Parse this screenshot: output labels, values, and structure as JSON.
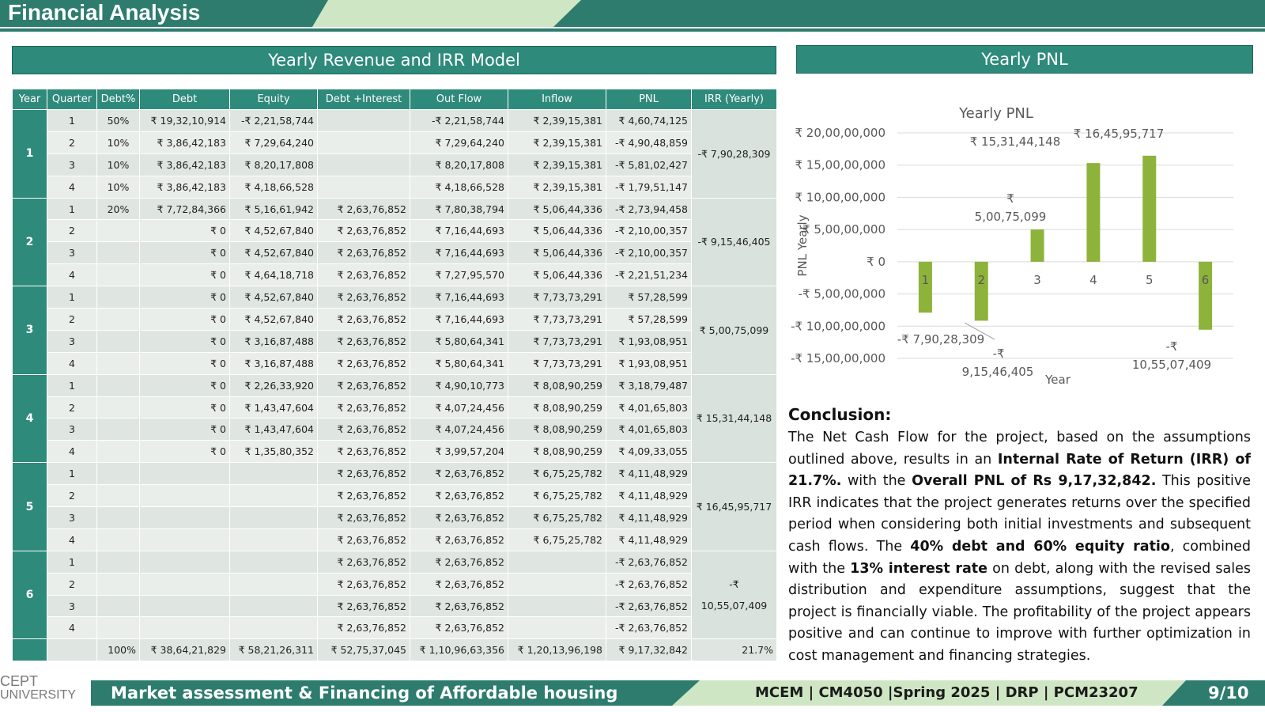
{
  "header": {
    "title": "Financial Analysis"
  },
  "table_section": {
    "title": "Yearly Revenue and IRR Model"
  },
  "chart_section": {
    "title": "Yearly PNL"
  },
  "table": {
    "columns": [
      "Year",
      "Quarter",
      "Debt%",
      "Debt",
      "Equity",
      "Debt +Interest",
      "Out Flow",
      "Inflow",
      "PNL",
      "IRR (Yearly)"
    ],
    "years": [
      {
        "year": "1",
        "irr": "-₹ 7,90,28,309",
        "rows": [
          [
            "1",
            "50%",
            "₹ 19,32,10,914",
            "-₹ 2,21,58,744",
            "",
            "-₹ 2,21,58,744",
            "₹ 2,39,15,381",
            "₹ 4,60,74,125"
          ],
          [
            "2",
            "10%",
            "₹ 3,86,42,183",
            "₹ 7,29,64,240",
            "",
            "₹ 7,29,64,240",
            "₹ 2,39,15,381",
            "-₹ 4,90,48,859"
          ],
          [
            "3",
            "10%",
            "₹ 3,86,42,183",
            "₹ 8,20,17,808",
            "",
            "₹ 8,20,17,808",
            "₹ 2,39,15,381",
            "-₹ 5,81,02,427"
          ],
          [
            "4",
            "10%",
            "₹ 3,86,42,183",
            "₹ 4,18,66,528",
            "",
            "₹ 4,18,66,528",
            "₹ 2,39,15,381",
            "-₹ 1,79,51,147"
          ]
        ]
      },
      {
        "year": "2",
        "irr": "-₹ 9,15,46,405",
        "rows": [
          [
            "1",
            "20%",
            "₹ 7,72,84,366",
            "₹ 5,16,61,942",
            "₹ 2,63,76,852",
            "₹ 7,80,38,794",
            "₹ 5,06,44,336",
            "-₹ 2,73,94,458"
          ],
          [
            "2",
            "",
            "₹ 0",
            "₹ 4,52,67,840",
            "₹ 2,63,76,852",
            "₹ 7,16,44,693",
            "₹ 5,06,44,336",
            "-₹ 2,10,00,357"
          ],
          [
            "3",
            "",
            "₹ 0",
            "₹ 4,52,67,840",
            "₹ 2,63,76,852",
            "₹ 7,16,44,693",
            "₹ 5,06,44,336",
            "-₹ 2,10,00,357"
          ],
          [
            "4",
            "",
            "₹ 0",
            "₹ 4,64,18,718",
            "₹ 2,63,76,852",
            "₹ 7,27,95,570",
            "₹ 5,06,44,336",
            "-₹ 2,21,51,234"
          ]
        ]
      },
      {
        "year": "3",
        "irr": "₹ 5,00,75,099",
        "rows": [
          [
            "1",
            "",
            "₹ 0",
            "₹ 4,52,67,840",
            "₹ 2,63,76,852",
            "₹ 7,16,44,693",
            "₹ 7,73,73,291",
            "₹ 57,28,599"
          ],
          [
            "2",
            "",
            "₹ 0",
            "₹ 4,52,67,840",
            "₹ 2,63,76,852",
            "₹ 7,16,44,693",
            "₹ 7,73,73,291",
            "₹ 57,28,599"
          ],
          [
            "3",
            "",
            "₹ 0",
            "₹ 3,16,87,488",
            "₹ 2,63,76,852",
            "₹ 5,80,64,341",
            "₹ 7,73,73,291",
            "₹ 1,93,08,951"
          ],
          [
            "4",
            "",
            "₹ 0",
            "₹ 3,16,87,488",
            "₹ 2,63,76,852",
            "₹ 5,80,64,341",
            "₹ 7,73,73,291",
            "₹ 1,93,08,951"
          ]
        ]
      },
      {
        "year": "4",
        "irr": "₹ 15,31,44,148",
        "rows": [
          [
            "1",
            "",
            "₹ 0",
            "₹ 2,26,33,920",
            "₹ 2,63,76,852",
            "₹ 4,90,10,773",
            "₹ 8,08,90,259",
            "₹ 3,18,79,487"
          ],
          [
            "2",
            "",
            "₹ 0",
            "₹ 1,43,47,604",
            "₹ 2,63,76,852",
            "₹ 4,07,24,456",
            "₹ 8,08,90,259",
            "₹ 4,01,65,803"
          ],
          [
            "3",
            "",
            "₹ 0",
            "₹ 1,43,47,604",
            "₹ 2,63,76,852",
            "₹ 4,07,24,456",
            "₹ 8,08,90,259",
            "₹ 4,01,65,803"
          ],
          [
            "4",
            "",
            "₹ 0",
            "₹ 1,35,80,352",
            "₹ 2,63,76,852",
            "₹ 3,99,57,204",
            "₹ 8,08,90,259",
            "₹ 4,09,33,055"
          ]
        ]
      },
      {
        "year": "5",
        "irr": "₹ 16,45,95,717",
        "rows": [
          [
            "1",
            "",
            "",
            "",
            "₹ 2,63,76,852",
            "₹ 2,63,76,852",
            "₹ 6,75,25,782",
            "₹ 4,11,48,929"
          ],
          [
            "2",
            "",
            "",
            "",
            "₹ 2,63,76,852",
            "₹ 2,63,76,852",
            "₹ 6,75,25,782",
            "₹ 4,11,48,929"
          ],
          [
            "3",
            "",
            "",
            "",
            "₹ 2,63,76,852",
            "₹ 2,63,76,852",
            "₹ 6,75,25,782",
            "₹ 4,11,48,929"
          ],
          [
            "4",
            "",
            "",
            "",
            "₹ 2,63,76,852",
            "₹ 2,63,76,852",
            "₹ 6,75,25,782",
            "₹ 4,11,48,929"
          ]
        ]
      },
      {
        "year": "6",
        "irr": "-₹ 10,55,07,409",
        "rows": [
          [
            "1",
            "",
            "",
            "",
            "₹ 2,63,76,852",
            "₹ 2,63,76,852",
            "",
            "-₹ 2,63,76,852"
          ],
          [
            "2",
            "",
            "",
            "",
            "₹ 2,63,76,852",
            "₹ 2,63,76,852",
            "",
            "-₹ 2,63,76,852"
          ],
          [
            "3",
            "",
            "",
            "",
            "₹ 2,63,76,852",
            "₹ 2,63,76,852",
            "",
            "-₹ 2,63,76,852"
          ],
          [
            "4",
            "",
            "",
            "",
            "₹ 2,63,76,852",
            "₹ 2,63,76,852",
            "",
            "-₹ 2,63,76,852"
          ]
        ]
      }
    ],
    "totals": [
      "",
      "",
      "100%",
      "₹ 38,64,21,829",
      "₹ 58,21,26,311",
      "₹ 52,75,37,045",
      "₹ 1,10,96,63,356",
      "₹ 1,20,13,96,198",
      "₹ 9,17,32,842",
      "21.7%"
    ]
  },
  "chart_data": {
    "type": "bar",
    "title": "Yearly PNL",
    "xlabel": "Year",
    "ylabel": "PNL Yearly",
    "categories": [
      "1",
      "2",
      "3",
      "4",
      "5",
      "6"
    ],
    "values": [
      -79028309,
      -91546405,
      50075099,
      153144148,
      164595717,
      -105507409
    ],
    "data_labels": [
      "-₹ 7,90,28,309",
      "-₹ 9,15,46,405",
      "₹ 5,00,75,099",
      "₹ 15,31,44,148",
      "₹ 16,45,95,717",
      "-₹ 10,55,07,409"
    ],
    "yticks": [
      {
        "value": 200000000,
        "label": "₹ 20,00,00,000"
      },
      {
        "value": 150000000,
        "label": "₹ 15,00,00,000"
      },
      {
        "value": 100000000,
        "label": "₹ 10,00,00,000"
      },
      {
        "value": 50000000,
        "label": "₹ 5,00,00,000"
      },
      {
        "value": 0,
        "label": "₹ 0"
      },
      {
        "value": -50000000,
        "label": "-₹ 5,00,00,000"
      },
      {
        "value": -100000000,
        "label": "-₹ 10,00,00,000"
      },
      {
        "value": -150000000,
        "label": "-₹ 15,00,00,000"
      }
    ],
    "ylim": [
      -150000000,
      200000000
    ],
    "grid": true,
    "bar_color": "#8db33a"
  },
  "conclusion": {
    "heading": "Conclusion:",
    "p1": "The Net Cash Flow for the project, based on the assumptions outlined above, results in an ",
    "b1": "Internal Rate of Return (IRR) of 21.7%.",
    "p2": " with the ",
    "b2": "Overall PNL of Rs 9,17,32,842.",
    "p3": " This positive IRR indicates that the project generates returns over the specified period when considering both initial investments and subsequent cash flows. The ",
    "b3": "40% debt and 60% equity ratio",
    "p4": ", combined with the ",
    "b4": "13% interest rate",
    "p5": " on debt, along with the revised sales distribution and expenditure assumptions, suggest that the project is financially viable. The profitability of the project appears positive and can continue to improve with further optimization in cost management and financing strategies."
  },
  "footer": {
    "logo_line1": "CEPT",
    "logo_line2": "UNIVERSITY",
    "left": "Market assessment & Financing of Affordable housing",
    "middle": "MCEM | CM4050 |Spring 2025 | DRP | PCM23207",
    "page": "9/10"
  }
}
